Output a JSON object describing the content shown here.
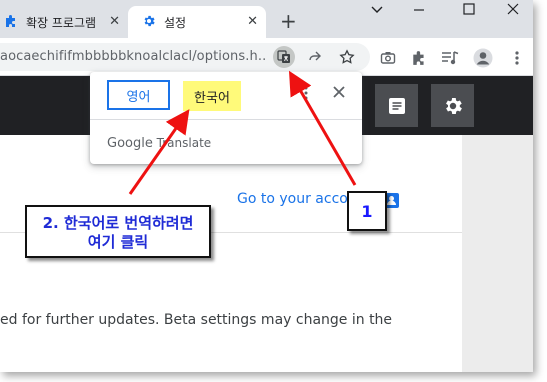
{
  "browser": {
    "tabs": [
      {
        "title": "확장 프로그램",
        "active": false,
        "favicon": "puzzle-icon"
      },
      {
        "title": "설정",
        "active": true,
        "favicon": "gear-icon"
      }
    ],
    "new_tab_symbol": "+",
    "close_symbol": "✕",
    "url": "aocaechififmbbbbbknoalclacl/options.h...",
    "accent_color": "#1a73e8"
  },
  "translate_popup": {
    "source_language": "영어",
    "target_language": "한국어",
    "brand_google": "Google",
    "brand_translate": "Translate"
  },
  "page": {
    "account_link": "Go to your acco",
    "body_text": "ed for further updates. Beta settings may change in the"
  },
  "annotations": {
    "callout_1": "1",
    "callout_2_line1": "2. 한국어로 번역하려면",
    "callout_2_line2": "여기 클릭",
    "arrow_color": "#ee1111",
    "highlight_color": "#fffa7a"
  }
}
